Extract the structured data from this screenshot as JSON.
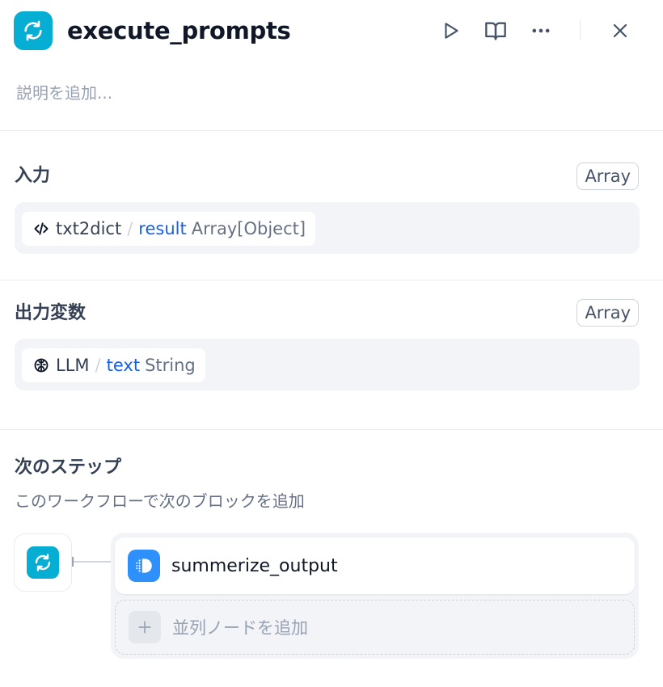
{
  "header": {
    "title": "execute_prompts",
    "icons": {
      "node": "loop-icon",
      "run": "play-icon",
      "docs": "book-open-icon",
      "more": "more-horizontal-icon",
      "close": "close-icon"
    }
  },
  "description": {
    "placeholder": "説明を追加..."
  },
  "input_section": {
    "title": "入力",
    "type_badge": "Array",
    "variable": {
      "icon": "code-icon",
      "node": "txt2dict",
      "separator": "/",
      "name": "result",
      "type": "Array[Object]"
    }
  },
  "output_section": {
    "title": "出力変数",
    "type_badge": "Array",
    "variable": {
      "icon": "llm-brain-icon",
      "node": "LLM",
      "separator": "/",
      "name": "text",
      "type": "String"
    }
  },
  "next_step": {
    "title": "次のステップ",
    "subtitle": "このワークフローで次のブロックを追加",
    "source_icon": "loop-icon",
    "next_node": {
      "icon": "answer-icon",
      "label": "summerize_output"
    },
    "add_parallel_label": "並列ノードを追加"
  },
  "colors": {
    "loop_icon_bg": "#06aed4",
    "answer_icon_bg": "#2e90fa",
    "variable_name": "#155eef"
  }
}
